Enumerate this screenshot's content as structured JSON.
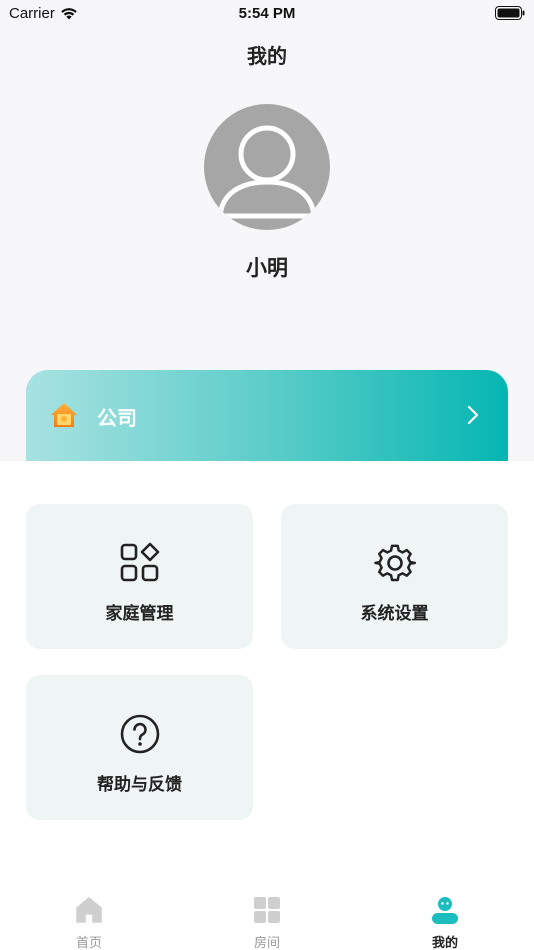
{
  "status_bar": {
    "carrier": "Carrier",
    "time": "5:54 PM"
  },
  "header": {
    "title": "我的"
  },
  "profile": {
    "name": "小明",
    "avatar_icon": "user-avatar-icon"
  },
  "family_card": {
    "label": "公司",
    "icon": "home-icon",
    "chevron": "chevron-right-icon"
  },
  "tiles": [
    {
      "label": "家庭管理",
      "icon": "grid-apps-icon"
    },
    {
      "label": "系统设置",
      "icon": "gear-icon"
    },
    {
      "label": "帮助与反馈",
      "icon": "help-icon"
    }
  ],
  "tabbar": {
    "items": [
      {
        "label": "首页",
        "icon": "home-tab-icon",
        "active": false
      },
      {
        "label": "房间",
        "icon": "room-grid-icon",
        "active": false
      },
      {
        "label": "我的",
        "icon": "profile-tab-icon",
        "active": true
      }
    ]
  },
  "colors": {
    "accent": "#05b6b3",
    "tile_bg": "#eff5f5",
    "top_bg": "#f7f7f9",
    "tab_inactive": "#999999"
  }
}
